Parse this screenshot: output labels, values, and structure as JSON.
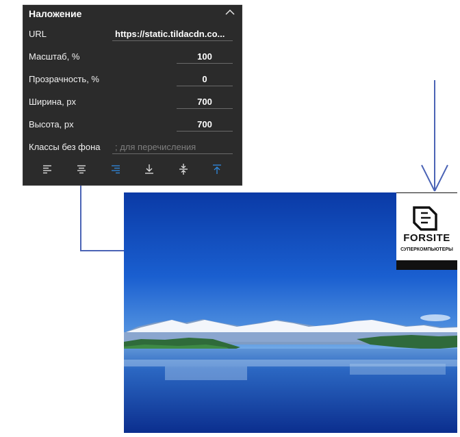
{
  "panel": {
    "title": "Наложение",
    "fields": {
      "url": {
        "label": "URL",
        "value": "https://static.tildacdn.co..."
      },
      "scale": {
        "label": "Масштаб, %",
        "value": "100"
      },
      "opacity": {
        "label": "Прозрачность, %",
        "value": "0"
      },
      "width": {
        "label": "Ширина, px",
        "value": "700"
      },
      "height": {
        "label": "Высота, px",
        "value": "700"
      },
      "classes": {
        "label": "Классы без фона",
        "placeholder": "; для перечисления"
      }
    },
    "toolbar": [
      {
        "name": "align-left-icon",
        "active": false
      },
      {
        "name": "align-center-icon",
        "active": false
      },
      {
        "name": "align-right-icon",
        "active": true
      },
      {
        "name": "align-bottom-icon",
        "active": false
      },
      {
        "name": "align-middle-icon",
        "active": false
      },
      {
        "name": "align-top-icon",
        "active": true
      }
    ],
    "colors": {
      "background": "#2b2b2b",
      "active": "#2f8ae0",
      "inactive": "#e6e6e6"
    }
  },
  "logo": {
    "brand": "FORSITE",
    "subtitle": "СУПЕРКОМПЬЮТЕРЫ"
  },
  "connector_color": "#4a63b5"
}
